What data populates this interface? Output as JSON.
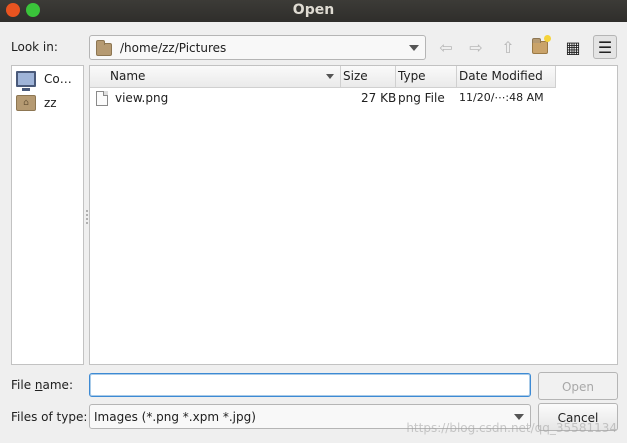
{
  "window": {
    "title": "Open",
    "icons": {
      "close": "close-icon",
      "maximize": "maximize-icon"
    }
  },
  "look_in": {
    "label": "Look in:",
    "path": "/home/zz/Pictures",
    "folder_icon": "folder-icon"
  },
  "toolbar": {
    "back_icon": "back-arrow-icon",
    "forward_icon": "forward-arrow-icon",
    "up_icon": "up-arrow-icon",
    "new_folder_icon": "new-folder-icon",
    "list_view_icon": "list-view-icon",
    "detail_view_icon": "detail-view-icon",
    "glyphs": {
      "back": "⇦",
      "forward": "⇨",
      "up": "⇧",
      "list": "▦",
      "detail": "☰"
    }
  },
  "sidebar": {
    "items": [
      {
        "label": "Co…",
        "icon": "computer-icon"
      },
      {
        "label": "zz",
        "icon": "home-folder-icon"
      }
    ]
  },
  "file_list": {
    "columns": [
      "Name",
      "Size",
      "Type",
      "Date Modified"
    ],
    "rows": [
      {
        "name": "view.png",
        "size": "27 KB",
        "type": "png File",
        "date": "11/20/⋯:48 AM",
        "icon": "image-file-icon"
      }
    ]
  },
  "file_name": {
    "label": "File name:",
    "value": ""
  },
  "file_type": {
    "label": "Files of type:",
    "selected": "Images (*.png *.xpm *.jpg)"
  },
  "buttons": {
    "open": "Open",
    "cancel": "Cancel"
  },
  "watermark": "https://blog.csdn.net/qq_35581134",
  "colors": {
    "titlebar": "#3c3b37",
    "close": "#e95420",
    "maximize": "#3ac43a",
    "focus_border": "#3d8ad4"
  }
}
